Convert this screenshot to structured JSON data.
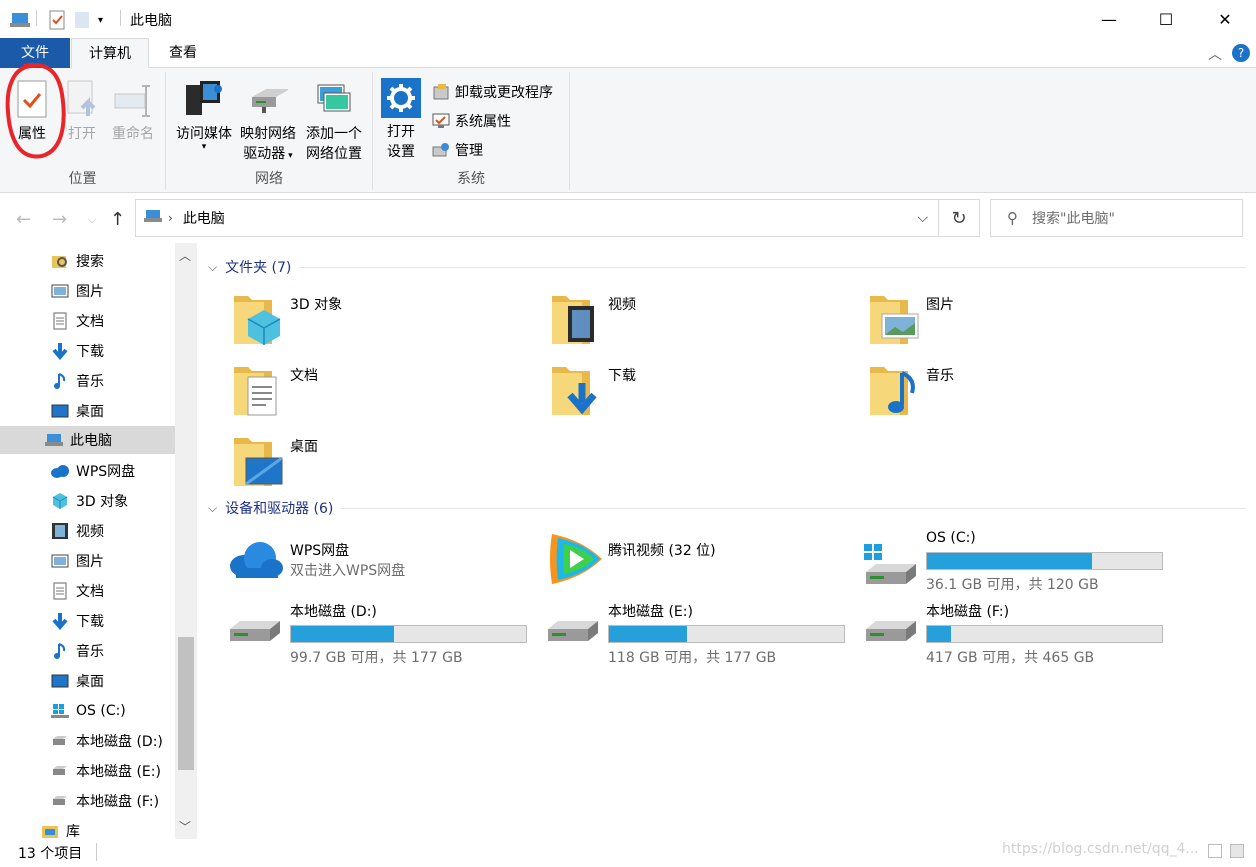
{
  "window": {
    "title": "此电脑",
    "minimize": "—",
    "maximize": "☐",
    "close": "✕"
  },
  "ribbon": {
    "tabs": [
      "文件",
      "计算机",
      "查看"
    ],
    "location_group": {
      "label": "位置",
      "properties": "属性",
      "open": "打开",
      "rename": "重命名"
    },
    "network_group": {
      "label": "网络",
      "media_l1": "访问媒体",
      "map_l1": "映射网络",
      "map_l2": "驱动器",
      "add_l1": "添加一个",
      "add_l2": "网络位置"
    },
    "system_group": {
      "label": "系统",
      "open_settings_l1": "打开",
      "open_settings_l2": "设置",
      "uninstall": "卸载或更改程序",
      "system_props": "系统属性",
      "manage": "管理"
    }
  },
  "address": {
    "path": "此电脑",
    "search_placeholder": "搜索\"此电脑\""
  },
  "sidebar": {
    "items": [
      "搜索",
      "图片",
      "文档",
      "下载",
      "音乐",
      "桌面",
      "此电脑",
      "WPS网盘",
      "3D 对象",
      "视频",
      "图片",
      "文档",
      "下载",
      "音乐",
      "桌面",
      "OS (C:)",
      "本地磁盘 (D:)",
      "本地磁盘 (E:)",
      "本地磁盘 (F:)",
      "库"
    ]
  },
  "folders": {
    "header": "文件夹 (7)",
    "items": [
      "3D 对象",
      "视频",
      "图片",
      "文档",
      "下载",
      "音乐",
      "桌面"
    ]
  },
  "devices": {
    "header": "设备和驱动器 (6)",
    "wps": {
      "name": "WPS网盘",
      "sub": "双击进入WPS网盘"
    },
    "tencent": {
      "name": "腾讯视频 (32 位)"
    },
    "drives": [
      {
        "name": "OS (C:)",
        "info": "36.1 GB 可用，共 120 GB",
        "used": 0.7
      },
      {
        "name": "本地磁盘 (D:)",
        "info": "99.7 GB 可用，共 177 GB",
        "used": 0.44
      },
      {
        "name": "本地磁盘 (E:)",
        "info": "118 GB 可用，共 177 GB",
        "used": 0.33
      },
      {
        "name": "本地磁盘 (F:)",
        "info": "417 GB 可用，共 465 GB",
        "used": 0.1
      }
    ]
  },
  "status": {
    "count": "13 个项目",
    "watermark": "https://blog.csdn.net/qq_4..."
  },
  "colors": {
    "accent": "#1a5aa8",
    "bar_fill": "#26a0da",
    "section_header": "#1e3287",
    "annotation": "#e8262a"
  }
}
